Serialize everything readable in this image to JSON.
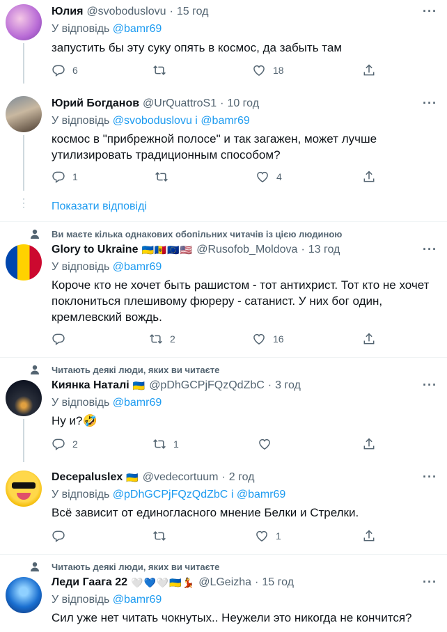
{
  "reply_prefix": "У відповідь",
  "and_word": "і",
  "show_replies": "Показати відповіді",
  "tweets": [
    {
      "name": "Юлия",
      "handle": "@svoboduslovu",
      "time": "15 год",
      "reply_to": [
        "@bamr69"
      ],
      "text": "запустить бы эту суку опять в космос, да забыть там",
      "replies": "6",
      "retweets": "",
      "likes": "18"
    },
    {
      "name": "Юрий Богданов",
      "handle": "@UrQuattroS1",
      "time": "10 год",
      "reply_to": [
        "@svoboduslovu",
        "@bamr69"
      ],
      "text": "космос в \"прибрежной полосе\" и так загажен, может лучше утилизировать традиционным способом?",
      "replies": "1",
      "retweets": "",
      "likes": "4"
    },
    {
      "social_context": "Ви маєте кілька однакових обопільних читачів із цією людиною",
      "name": "Glory to Ukraine",
      "flags": "🇺🇦🇲🇩🇪🇺🇺🇸",
      "handle": "@Rusofob_Moldova",
      "time": "13 год",
      "reply_to": [
        "@bamr69"
      ],
      "text": "Короче кто не хочет быть рашистом - тот антихрист. Тот кто не хочет поклониться плешивому фюреру - сатанист. У них бог один, кремлевский вождь.",
      "replies": "",
      "retweets": "2",
      "likes": "16"
    },
    {
      "social_context": "Читають деякі люди, яких ви читаєте",
      "name": "Киянка Наталі",
      "flags": "🇺🇦",
      "handle": "@pDhGCPjFQzQdZbC",
      "time": "3 год",
      "reply_to": [
        "@bamr69"
      ],
      "text": "Ну и?🤣",
      "replies": "2",
      "retweets": "1",
      "likes": ""
    },
    {
      "name": "Decepaluslex",
      "flags": "🇺🇦",
      "handle": "@vedecortuum",
      "time": "2 год",
      "reply_to": [
        "@pDhGCPjFQzQdZbC",
        "@bamr69"
      ],
      "text": "Всё зависит от единогласного мнение Белки и Стрелки.",
      "replies": "",
      "retweets": "",
      "likes": "1"
    },
    {
      "social_context": "Читають деякі люди, яких ви читаєте",
      "name": "Леди Гаага 22",
      "flags": "🤍💙🤍🇺🇦💃",
      "handle": "@LGeizha",
      "time": "15 год",
      "reply_to": [
        "@bamr69"
      ],
      "text": "Сил уже нет читать чокнутых.. Неужели это никогда не кончится?",
      "replies": "",
      "retweets": "",
      "likes": ""
    }
  ],
  "colors": {
    "accent": "#1d9bf0",
    "muted": "#536471",
    "divider": "#eff3f4"
  }
}
